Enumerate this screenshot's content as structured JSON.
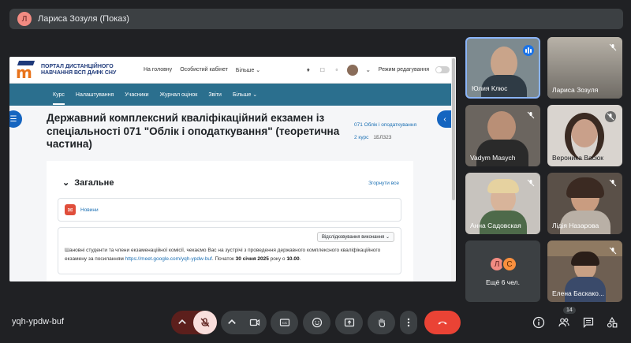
{
  "presenter": {
    "avatar_letter": "Л",
    "name": "Лариса Зозуля (Показ)"
  },
  "moodle": {
    "logo_line1": "ПОРТАЛ ДИСТАНЦІЙНОГО",
    "logo_line2": "НАВЧАННЯ ВСП ДАФК СНУ",
    "top_nav": [
      "На головну",
      "Особистий кабінет",
      "Більше ⌄"
    ],
    "edit_mode_label": "Режим редагування",
    "course_tabs": [
      "Курс",
      "Налаштування",
      "Учасники",
      "Журнал оцінок",
      "Звіти",
      "Більше ⌄"
    ],
    "course_title": "Державний комплексний кваліфікаційний екзамен із спеціальності 071 \"Облік і оподаткування\" (теоретична частина)",
    "crumb_category": "071 Облік і оподаткування",
    "crumb_year": "2 курс",
    "crumb_group": "1БЛ323",
    "section_title": "Загальне",
    "collapse_all": "Згорнути все",
    "news_label": "Новини",
    "track_button": "Відслідковування виконання ⌄",
    "announcement_text_1": "Шановні студенти та члени екзаменаційної комісії, чекаємо Вас на зустрічі з проведення державного комплексного кваліфікаційного екзамену за посиланням ",
    "announcement_link": "https://meet.google.com/yqh-ypdw-buf",
    "announcement_text_2": ". Початок ",
    "announcement_date": "30 січня 2025",
    "announcement_text_3": " року о ",
    "announcement_time": "10.00",
    "announcement_end": "."
  },
  "participants": [
    {
      "name": "Юлия Клюс",
      "speaking": true
    },
    {
      "name": "Лариса Зозуля",
      "muted": true
    },
    {
      "name": "Vadym Masych",
      "muted": true
    },
    {
      "name": "Вероника Васюк",
      "muted": true
    },
    {
      "name": "Анна Садовская",
      "muted": true
    },
    {
      "name": "Лідія Назарова",
      "muted": true
    },
    {
      "name": "Елена Баскако...",
      "muted": true
    }
  ],
  "more_tile": {
    "avatars": [
      "Л",
      "С"
    ],
    "label": "Ещё 6 чел."
  },
  "meeting": {
    "code": "yqh-ypdw-buf",
    "participant_count": "14"
  },
  "colors": {
    "end_call": "#ea4335",
    "mic_off_bg": "#f9dedc",
    "accent": "#8ab4f8"
  }
}
